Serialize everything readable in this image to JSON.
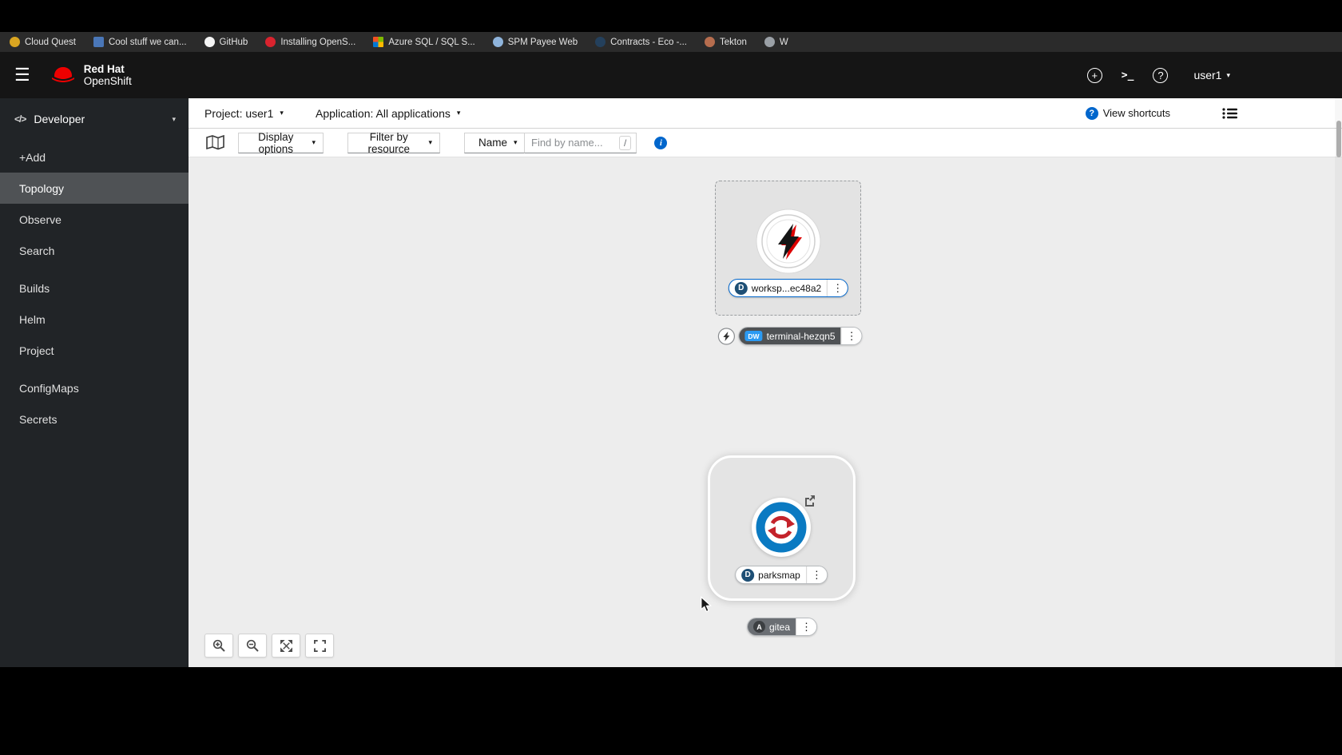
{
  "bookmarks": {
    "items": [
      {
        "label": "Cloud Quest",
        "color": "#d9a521"
      },
      {
        "label": "Cool stuff we can...",
        "color": "#4a77b8"
      },
      {
        "label": "GitHub",
        "color": "#f5f5f5"
      },
      {
        "label": "Installing OpenS...",
        "color": "#d9232e"
      },
      {
        "label": "Azure SQL / SQL S...",
        "color": null
      },
      {
        "label": "SPM Payee Web",
        "color": "#8fb4dc"
      },
      {
        "label": "Contracts - Eco -...",
        "color": "#24405c"
      },
      {
        "label": "Tekton",
        "color": "#b66d4e"
      },
      {
        "label": "W",
        "color": "#9aa0a6"
      }
    ]
  },
  "masthead": {
    "brand_top": "Red Hat",
    "brand_bottom": "OpenShift",
    "user": "user1"
  },
  "sidebar": {
    "perspective": "Developer",
    "active_item": "Topology",
    "groups": [
      {
        "items": [
          "+Add",
          "Topology",
          "Observe",
          "Search"
        ]
      },
      {
        "items": [
          "Builds",
          "Helm",
          "Project"
        ]
      },
      {
        "items": [
          "ConfigMaps",
          "Secrets"
        ]
      }
    ]
  },
  "context_bar": {
    "project": "Project: user1",
    "application": "Application: All applications",
    "view_shortcuts": "View shortcuts"
  },
  "toolbar": {
    "display_options": "Display options",
    "filter_by_resource": "Filter by resource",
    "name_filter": "Name",
    "search_placeholder": "Find by name...",
    "shortcut_hint": "/"
  },
  "topology": {
    "nodes": [
      {
        "id": "workspace",
        "badge": "D",
        "label": "worksp...ec48a2",
        "selected": true
      },
      {
        "id": "terminal",
        "badge": "DW",
        "label": "terminal-hezqn5"
      },
      {
        "id": "parksmap",
        "badge": "D",
        "label": "parksmap"
      },
      {
        "id": "gitea",
        "badge": "A",
        "label": "gitea"
      }
    ]
  },
  "icons": {
    "hamburger": "☰",
    "kebab": "⋮",
    "caret_down": "▾",
    "terminal": ">_",
    "developer": "</>",
    "plus": "+",
    "help": "?",
    "info": "i"
  },
  "colors": {
    "accent": "#0066cc",
    "masthead-bg": "#151515",
    "sidebar-bg": "#212427",
    "sidebar-active-bg": "#4f5255",
    "canvas-bg": "#ededed",
    "bookmark-bar-bg": "#2b2b2b",
    "badge-deployment": "#1e4f75",
    "badge-devworkspace": "#2b9af3",
    "badge-gray": "#3c3f42",
    "parksmap-blue": "#0a7ac2",
    "parksmap-red": "#c4232b"
  }
}
